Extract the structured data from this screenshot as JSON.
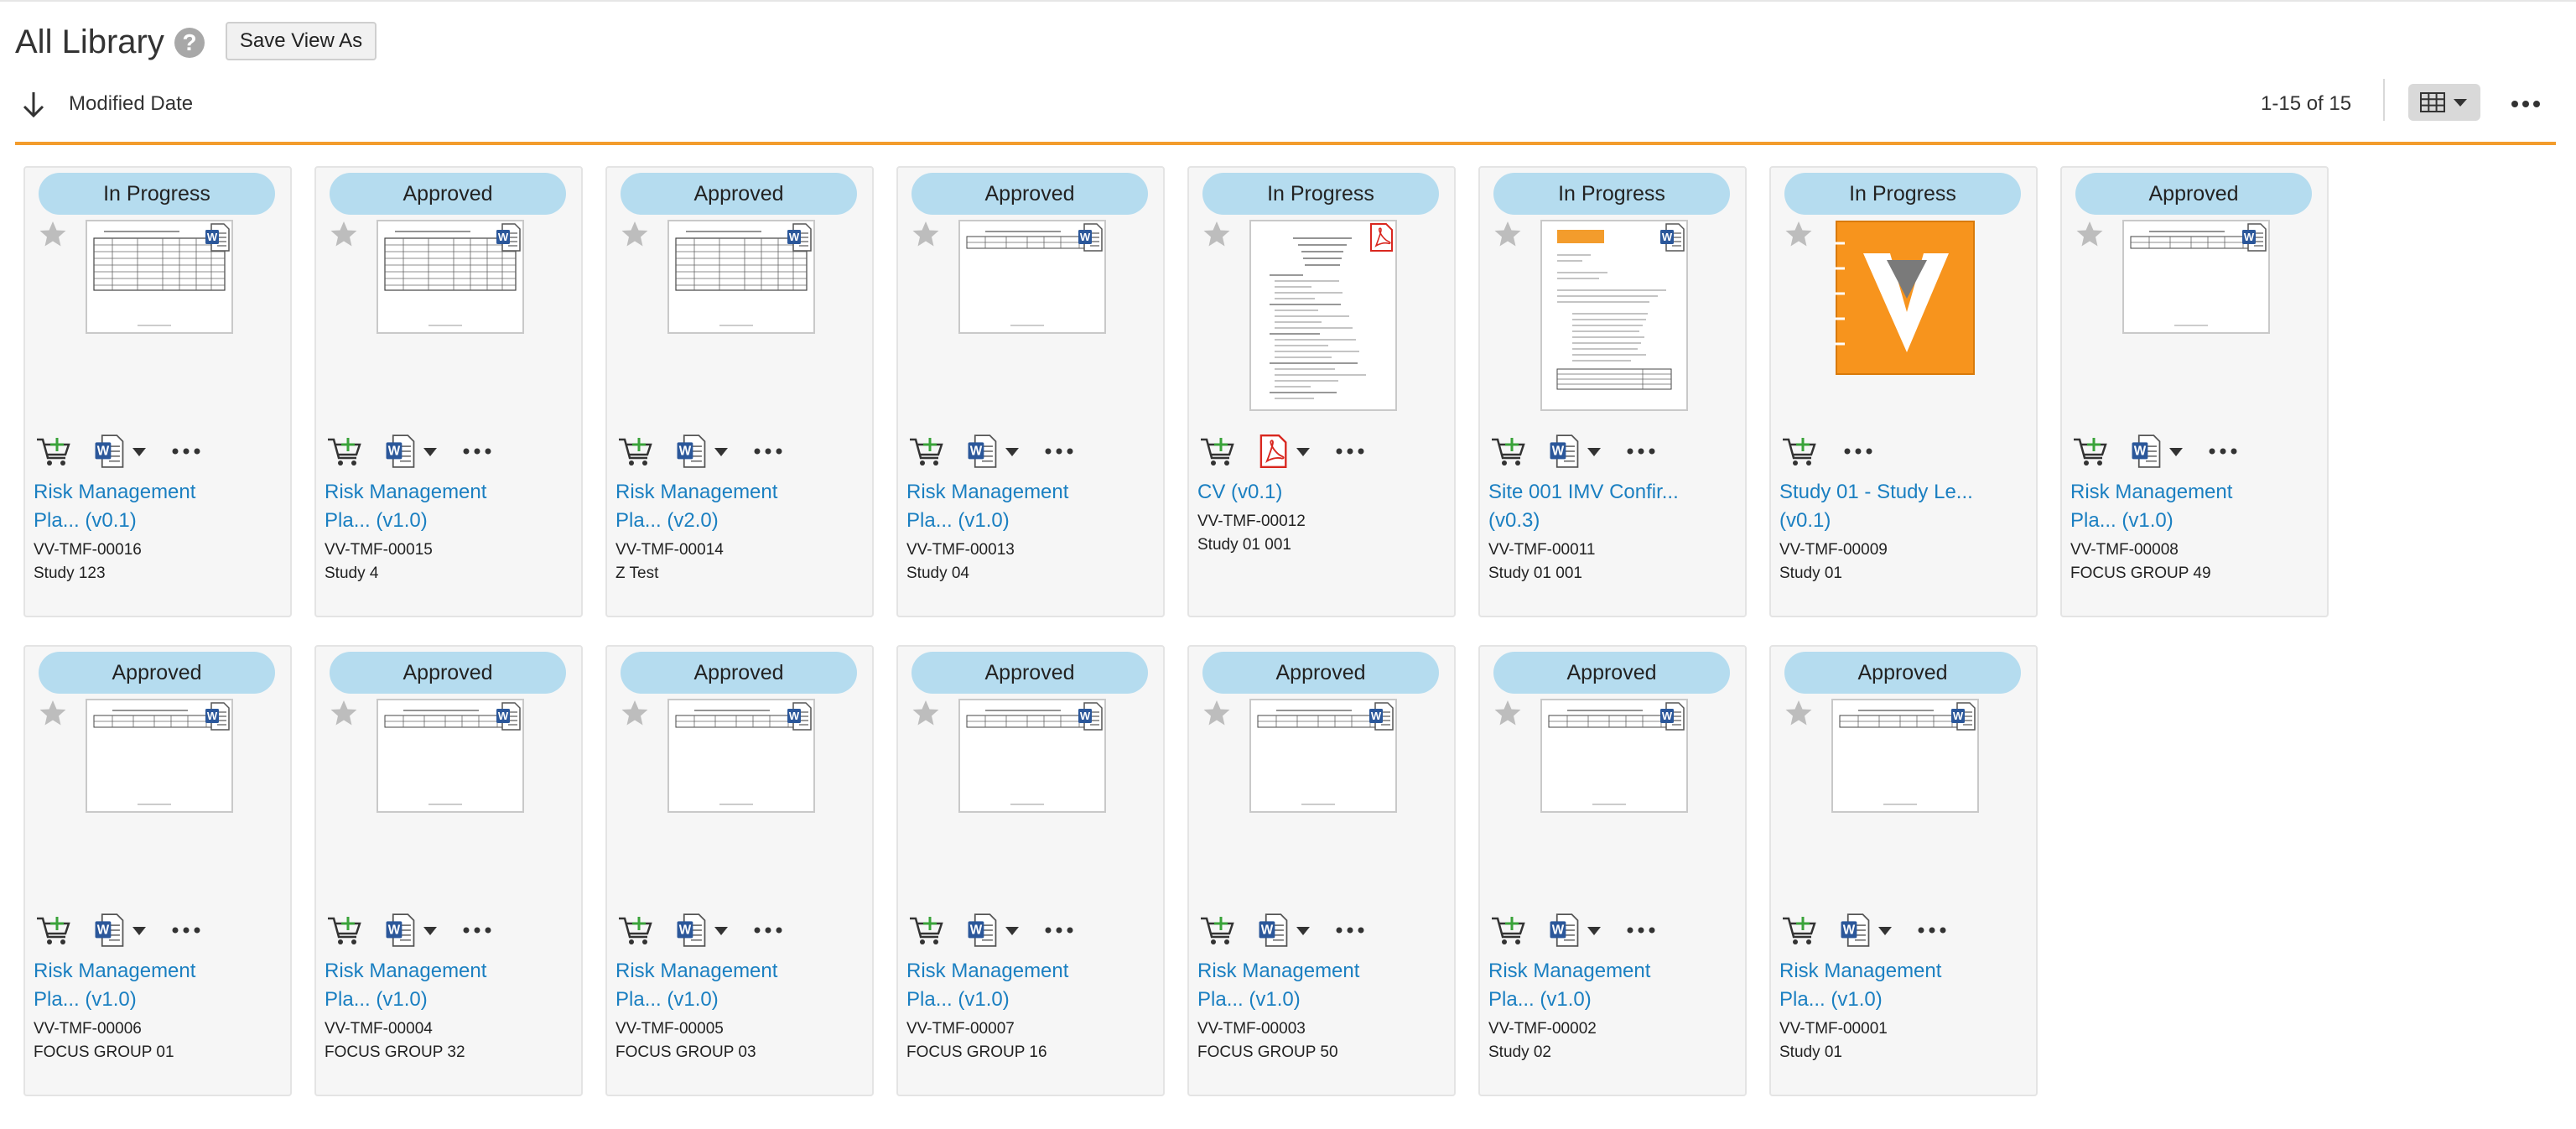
{
  "header": {
    "title": "All Library",
    "help_icon": "question-circle-icon",
    "save_view_label": "Save View As"
  },
  "toolbar": {
    "sort_icon": "arrow-down-icon",
    "sort_label": "Modified Date",
    "count": "1-15 of 15",
    "view_icon": "grid-view-icon",
    "more_icon": "ellipsis-icon"
  },
  "colors": {
    "accent": "#f39c2c",
    "link": "#1a7fc1",
    "status_pill": "#b5dcef",
    "word_blue": "#2b579a",
    "pdf_red": "#d9271f",
    "cart_green": "#3aa33a"
  },
  "cards": [
    {
      "status": "In Progress",
      "title": "Risk Management\nPla... (v0.1)",
      "number": "VV-TMF-00016",
      "study": "Study 123",
      "type": "word",
      "thumb": "table"
    },
    {
      "status": "Approved",
      "title": "Risk Management\nPla... (v1.0)",
      "number": "VV-TMF-00015",
      "study": "Study 4",
      "type": "word",
      "thumb": "table"
    },
    {
      "status": "Approved",
      "title": "Risk Management\nPla... (v2.0)",
      "number": "VV-TMF-00014",
      "study": "Z Test",
      "type": "word",
      "thumb": "table"
    },
    {
      "status": "Approved",
      "title": "Risk Management\nPla... (v1.0)",
      "number": "VV-TMF-00013",
      "study": "Study 04",
      "type": "word",
      "thumb": "landscape"
    },
    {
      "status": "In Progress",
      "title": "CV (v0.1)",
      "number": "VV-TMF-00012",
      "study": "Study 01 001",
      "type": "pdf",
      "thumb": "cv"
    },
    {
      "status": "In Progress",
      "title": "Site 001 IMV Confir...\n(v0.3)",
      "number": "VV-TMF-00011",
      "study": "Study 01 001",
      "type": "word",
      "thumb": "letter"
    },
    {
      "status": "In Progress",
      "title": "Study 01 - Study Le...\n(v0.1)",
      "number": "VV-TMF-00009",
      "study": "Study 01",
      "type": "none",
      "thumb": "logo"
    },
    {
      "status": "Approved",
      "title": "Risk Management\nPla... (v1.0)",
      "number": "VV-TMF-00008",
      "study": "FOCUS GROUP 49",
      "type": "word",
      "thumb": "landscape"
    },
    {
      "status": "Approved",
      "title": "Risk Management\nPla... (v1.0)",
      "number": "VV-TMF-00006",
      "study": "FOCUS GROUP 01",
      "type": "word",
      "thumb": "landscape"
    },
    {
      "status": "Approved",
      "title": "Risk Management\nPla... (v1.0)",
      "number": "VV-TMF-00004",
      "study": "FOCUS GROUP 32",
      "type": "word",
      "thumb": "landscape"
    },
    {
      "status": "Approved",
      "title": "Risk Management\nPla... (v1.0)",
      "number": "VV-TMF-00005",
      "study": "FOCUS GROUP 03",
      "type": "word",
      "thumb": "landscape"
    },
    {
      "status": "Approved",
      "title": "Risk Management\nPla... (v1.0)",
      "number": "VV-TMF-00007",
      "study": "FOCUS GROUP 16",
      "type": "word",
      "thumb": "landscape"
    },
    {
      "status": "Approved",
      "title": "Risk Management\nPla... (v1.0)",
      "number": "VV-TMF-00003",
      "study": "FOCUS GROUP 50",
      "type": "word",
      "thumb": "landscape"
    },
    {
      "status": "Approved",
      "title": "Risk Management\nPla... (v1.0)",
      "number": "VV-TMF-00002",
      "study": "Study 02",
      "type": "word",
      "thumb": "landscape"
    },
    {
      "status": "Approved",
      "title": "Risk Management\nPla... (v1.0)",
      "number": "VV-TMF-00001",
      "study": "Study 01",
      "type": "word",
      "thumb": "landscape"
    }
  ]
}
